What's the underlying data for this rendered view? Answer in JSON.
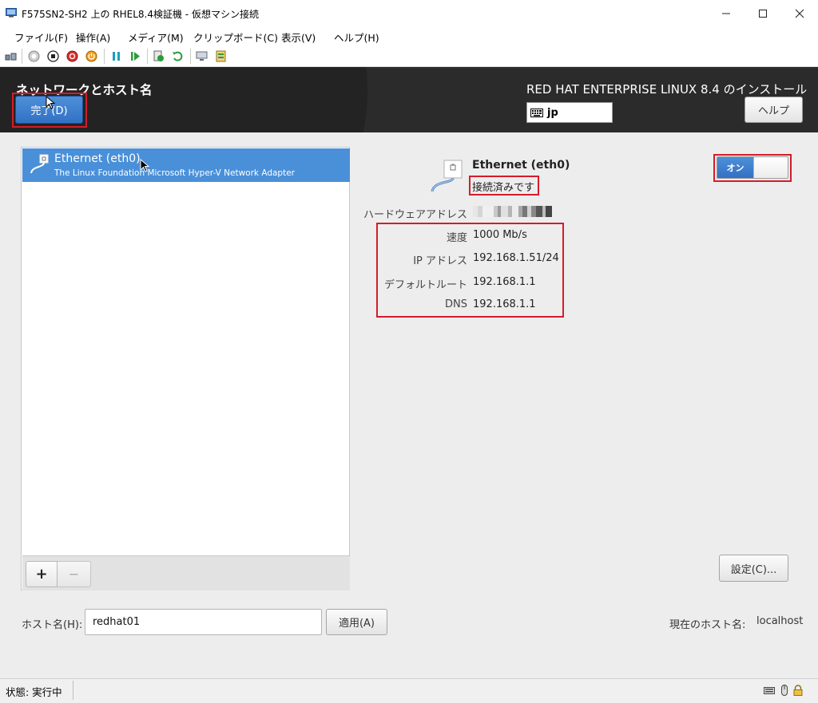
{
  "window": {
    "title": "F575SN2-SH2 上の RHEL8.4検証機 - 仮想マシン接続"
  },
  "menu": [
    "ファイル(F)",
    "操作(A)",
    "メディア(M)",
    "クリップボード(C)",
    "表示(V)",
    "ヘルプ(H)"
  ],
  "header": {
    "page_title": "ネットワークとホスト名",
    "done_label": "完了(D)",
    "install_title": "RED HAT ENTERPRISE LINUX 8.4 のインストール",
    "keyboard_layout": "jp",
    "help_label": "ヘルプ"
  },
  "devices": [
    {
      "name": "Ethernet (eth0)",
      "description": "The Linux Foundation Microsoft Hyper-V Network Adapter"
    }
  ],
  "list_controls": {
    "add": "+",
    "remove": "−"
  },
  "detail": {
    "name": "Ethernet (eth0)",
    "status": "接続済みです",
    "toggle_label": "オン",
    "hardware_address_label": "ハードウェアアドレス",
    "speed_label": "速度",
    "speed_value": "1000 Mb/s",
    "ip_label": "IP アドレス",
    "ip_value": "192.168.1.51/24",
    "route_label": "デフォルトルート",
    "route_value": "192.168.1.1",
    "dns_label": "DNS",
    "dns_value": "192.168.1.1",
    "settings_label": "設定(C)..."
  },
  "hostname": {
    "label": "ホスト名(H):",
    "value": "redhat01",
    "apply_label": "適用(A)",
    "current_label": "現在のホスト名:",
    "current_value": "localhost"
  },
  "statusbar": {
    "text": "状態: 実行中"
  },
  "colors": {
    "accent": "#4a90d9",
    "highlight": "#d41c2c",
    "header": "#2b2b2b"
  }
}
